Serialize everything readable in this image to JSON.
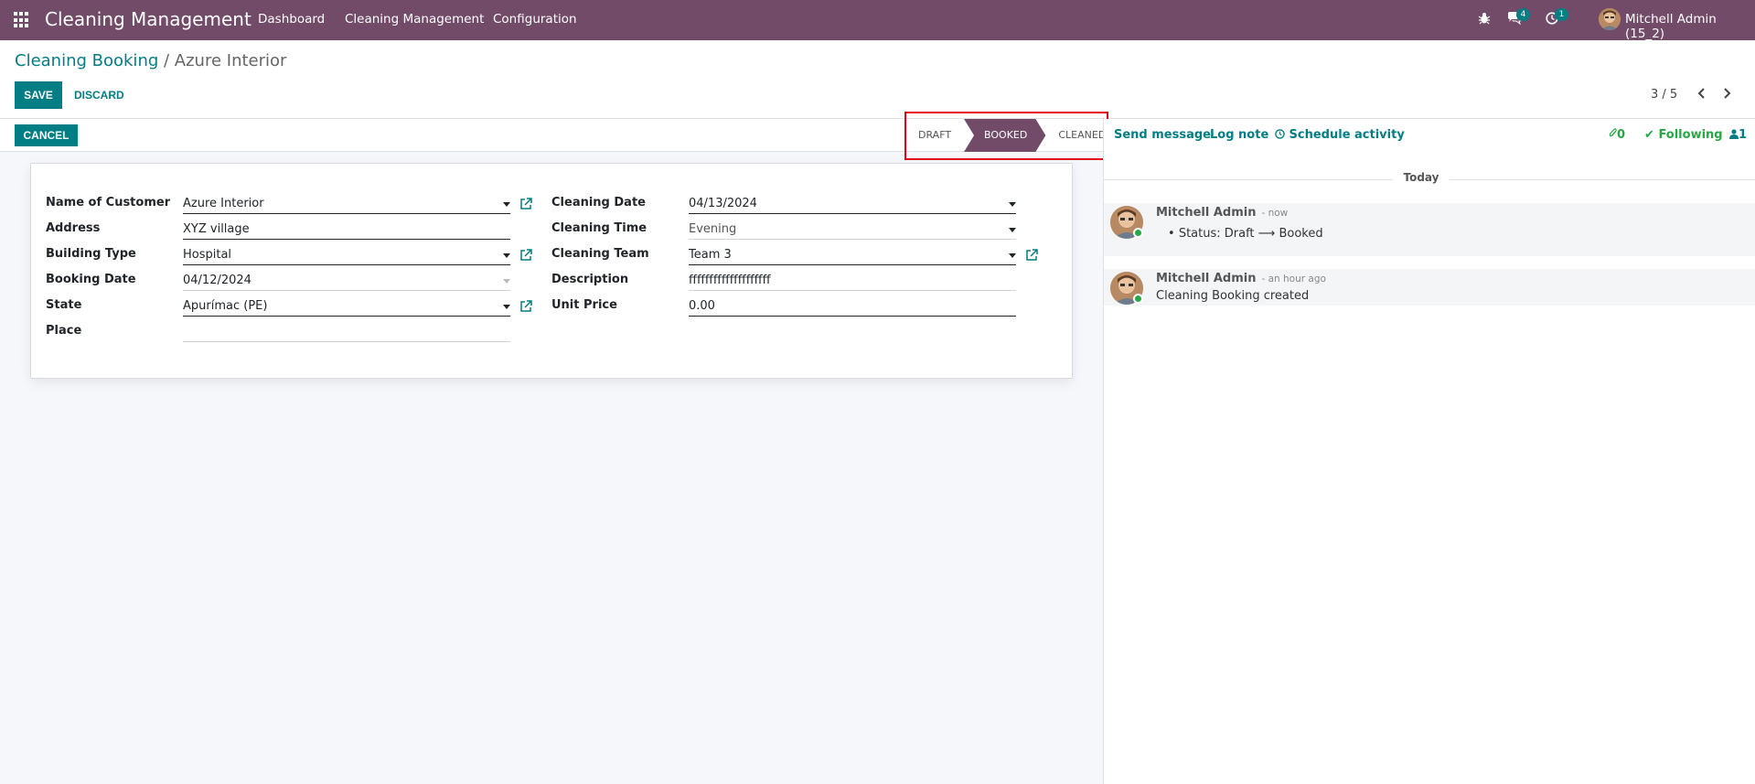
{
  "navbar": {
    "brand": "Cleaning Management",
    "menu": [
      "Dashboard",
      "Cleaning Management",
      "Configuration"
    ],
    "messages_count": "4",
    "activities_count": "1",
    "user_name": "Mitchell Admin (15_2)"
  },
  "breadcrumb": {
    "parent": "Cleaning Booking",
    "separator": " / ",
    "current": "Azure Interior"
  },
  "actions": {
    "save": "SAVE",
    "discard": "DISCARD",
    "cancel": "CANCEL"
  },
  "pager": {
    "text": "3 / 5"
  },
  "stages": {
    "draft": "DRAFT",
    "booked": "BOOKED",
    "cleaned": "CLEANED",
    "active": "BOOKED"
  },
  "form": {
    "left": [
      {
        "label": "Name of Customer",
        "value": "Azure Interior"
      },
      {
        "label": "Address",
        "value": "XYZ village"
      },
      {
        "label": "Building Type",
        "value": "Hospital"
      },
      {
        "label": "Booking Date",
        "value": "04/12/2024"
      },
      {
        "label": "State",
        "value": "Apurímac (PE)"
      },
      {
        "label": "Place",
        "value": ""
      }
    ],
    "right": [
      {
        "label": "Cleaning Date",
        "value": "04/13/2024"
      },
      {
        "label": "Cleaning Time",
        "value": "Evening"
      },
      {
        "label": "Cleaning Team",
        "value": "Team 3"
      },
      {
        "label": "Description",
        "value": "ffffffffffffffffffff"
      },
      {
        "label": "Unit Price",
        "value": "0.00"
      }
    ]
  },
  "chatter": {
    "send_message": "Send message",
    "log_note": "Log note",
    "schedule_activity": "Schedule activity",
    "attachments_count": "0",
    "following": "Following",
    "followers_count": "1",
    "date_separator": "Today",
    "messages": [
      {
        "author": "Mitchell Admin",
        "time": "- now",
        "body": "Status: Draft",
        "arrow": "⟶",
        "body_to": "Booked"
      },
      {
        "author": "Mitchell Admin",
        "time": "- an hour ago",
        "body": "Cleaning Booking created"
      }
    ]
  },
  "colors": {
    "brand": "#714b67",
    "primary": "#017e84",
    "success": "#28a745",
    "highlight": "#e3001b"
  }
}
